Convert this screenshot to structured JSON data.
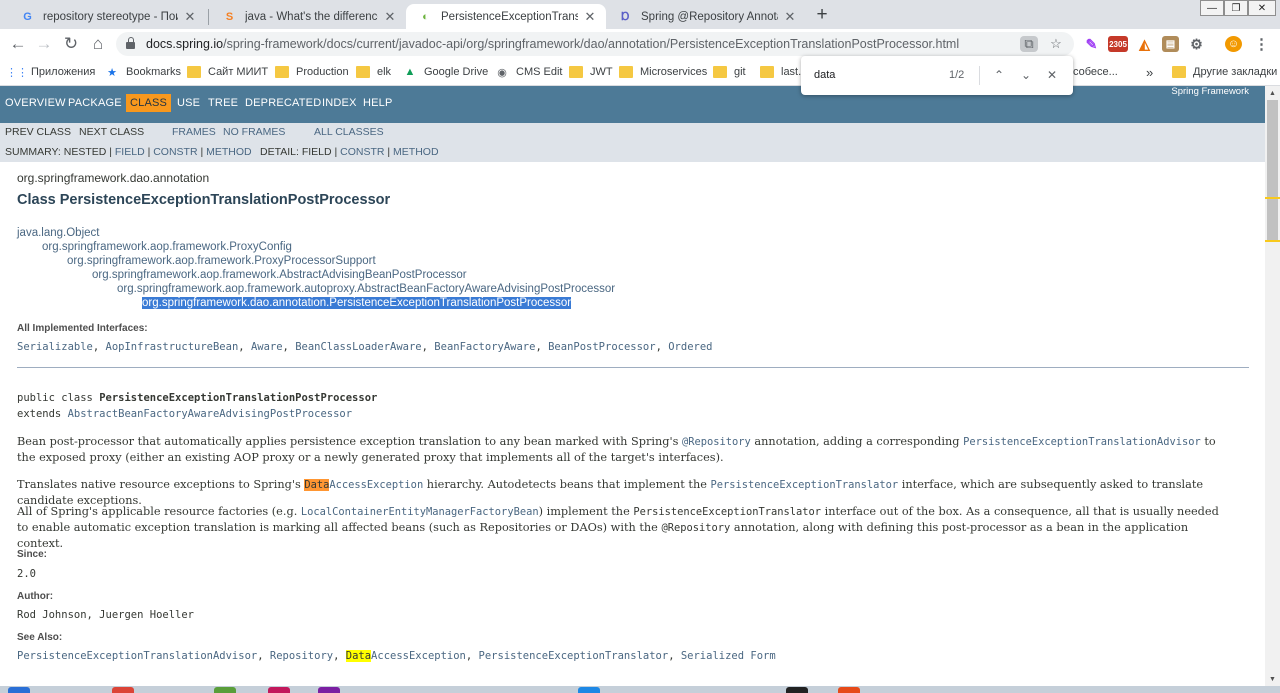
{
  "tabs": [
    {
      "title": "repository stereotype - Поиск в Google",
      "favicon": "G",
      "favicon_color": "#4285f4",
      "active": false
    },
    {
      "title": "java - What's the difference betw",
      "favicon": "S",
      "favicon_color": "#f48024",
      "active": false
    },
    {
      "title": "PersistenceExceptionTranslationP",
      "favicon": "◐",
      "favicon_color": "#6db33f",
      "active": true
    },
    {
      "title": "Spring @Repository Annotation",
      "favicon": "Ɒ",
      "favicon_color": "#5b5fc7",
      "active": false
    }
  ],
  "newtab": "+",
  "window_controls": {
    "minimize": "—",
    "restore": "❐",
    "close": "✕"
  },
  "toolbar": {
    "back": "←",
    "forward": "→",
    "reload": "↻",
    "home": "⌂",
    "url_host": "docs.spring.io",
    "url_path": "/spring-framework/docs/current/javadoc-api/org/springframework/dao/annotation/PersistenceExceptionTranslationPostProcessor.html",
    "badge": "2305",
    "star": "☆",
    "menu": "⋮"
  },
  "bookmarks": [
    {
      "label": "Приложения",
      "icon": "apps-icon"
    },
    {
      "label": "Bookmarks",
      "icon": "star-icon"
    },
    {
      "label": "Сайт МИИТ",
      "icon": "folder-icon"
    },
    {
      "label": "Production",
      "icon": "folder-icon"
    },
    {
      "label": "elk",
      "icon": "folder-icon"
    },
    {
      "label": "Google Drive",
      "icon": "drive-icon"
    },
    {
      "label": "CMS Edit",
      "icon": "cms-icon"
    },
    {
      "label": "JWT",
      "icon": "folder-icon"
    },
    {
      "label": "Microservices",
      "icon": "folder-icon"
    },
    {
      "label": "git",
      "icon": "folder-icon"
    },
    {
      "label": "last.f",
      "icon": "folder-icon"
    },
    {
      "label": "собесе...",
      "icon": "folder-icon"
    },
    {
      "label": "»",
      "icon": ""
    },
    {
      "label": "Другие закладки",
      "icon": "folder-icon"
    }
  ],
  "findbar": {
    "query": "data",
    "count": "1/2",
    "prev": "⌃",
    "next": "⌄",
    "close": "✕"
  },
  "javadoc": {
    "nav": [
      "OVERVIEW",
      "PACKAGE",
      "CLASS",
      "USE",
      "TREE",
      "DEPRECATED",
      "INDEX",
      "HELP"
    ],
    "brand": "Spring Framework",
    "subnav": {
      "prev": "PREV CLASS",
      "next": "NEXT CLASS",
      "frames": "FRAMES",
      "noframes": "NO FRAMES",
      "allclasses": "ALL CLASSES",
      "summary_prefix": "SUMMARY: NESTED | ",
      "summary_field": "FIELD",
      "summary_sep1": " | ",
      "summary_constr": "CONSTR",
      "summary_sep2": " | ",
      "summary_method": "METHOD",
      "detail_prefix": "DETAIL: FIELD | ",
      "detail_constr": "CONSTR",
      "detail_sep": " | ",
      "detail_method": "METHOD"
    },
    "package": "org.springframework.dao.annotation",
    "class_title": "Class PersistenceExceptionTranslationPostProcessor",
    "inheritance": [
      "java.lang.Object",
      "org.springframework.aop.framework.ProxyConfig",
      "org.springframework.aop.framework.ProxyProcessorSupport",
      "org.springframework.aop.framework.AbstractAdvisingBeanPostProcessor",
      "org.springframework.aop.framework.autoproxy.AbstractBeanFactoryAwareAdvisingPostProcessor",
      "org.springframework.dao.annotation.PersistenceExceptionTranslationPostProcessor"
    ],
    "interfaces_label": "All Implemented Interfaces:",
    "interfaces": [
      "Serializable",
      "AopInfrastructureBean",
      "Aware",
      "BeanClassLoaderAware",
      "BeanFactoryAware",
      "BeanPostProcessor",
      "Ordered"
    ],
    "signature": {
      "prefix": "public class ",
      "name": "PersistenceExceptionTranslationPostProcessor",
      "extends": "extends ",
      "super": "AbstractBeanFactoryAwareAdvisingPostProcessor"
    },
    "p1": {
      "a": "Bean post-processor that automatically applies persistence exception translation to any bean marked with Spring's ",
      "b": "@Repository",
      "c": " annotation, adding a corresponding ",
      "d": "PersistenceExceptionTranslationAdvisor",
      "e": " to the exposed proxy (either an existing AOP proxy or a newly generated proxy that implements all of the target's interfaces)."
    },
    "p2": {
      "a": "Translates native resource exceptions to Spring's ",
      "hl": "Data",
      "b": "AccessException",
      "c": " hierarchy. Autodetects beans that implement the ",
      "d": "PersistenceExceptionTranslator",
      "e": " interface, which are subsequently asked to translate candidate exceptions."
    },
    "p3": {
      "a": "All of Spring's applicable resource factories (e.g. ",
      "b": "LocalContainerEntityManagerFactoryBean",
      "c": ") implement the ",
      "d": "PersistenceExceptionTranslator",
      "e": " interface out of the box. As a consequence, all that is usually needed to enable automatic exception translation is marking all affected beans (such as Repositories or DAOs) with the ",
      "f": "@Repository",
      "g": " annotation, along with defining this post-processor as a bean in the application context."
    },
    "since_label": "Since:",
    "since": "2.0",
    "author_label": "Author:",
    "author": "Rod Johnson, Juergen Hoeller",
    "seealso_label": "See Also:",
    "seealso": {
      "a": "PersistenceExceptionTranslationAdvisor",
      "s1": ", ",
      "b": "Repository",
      "s2": ", ",
      "hl": "Data",
      "c": "AccessException",
      "s3": ", ",
      "d": "PersistenceExceptionTranslator",
      "s4": ", ",
      "e": "Serialized Form"
    }
  },
  "colors": {
    "nav_bg": "#4d7a97",
    "active_nav": "#f8981d",
    "subnav_bg": "#dee3e9",
    "link": "#4a6782",
    "highlight_current": "#ff9632",
    "highlight_other": "#ffff00"
  }
}
